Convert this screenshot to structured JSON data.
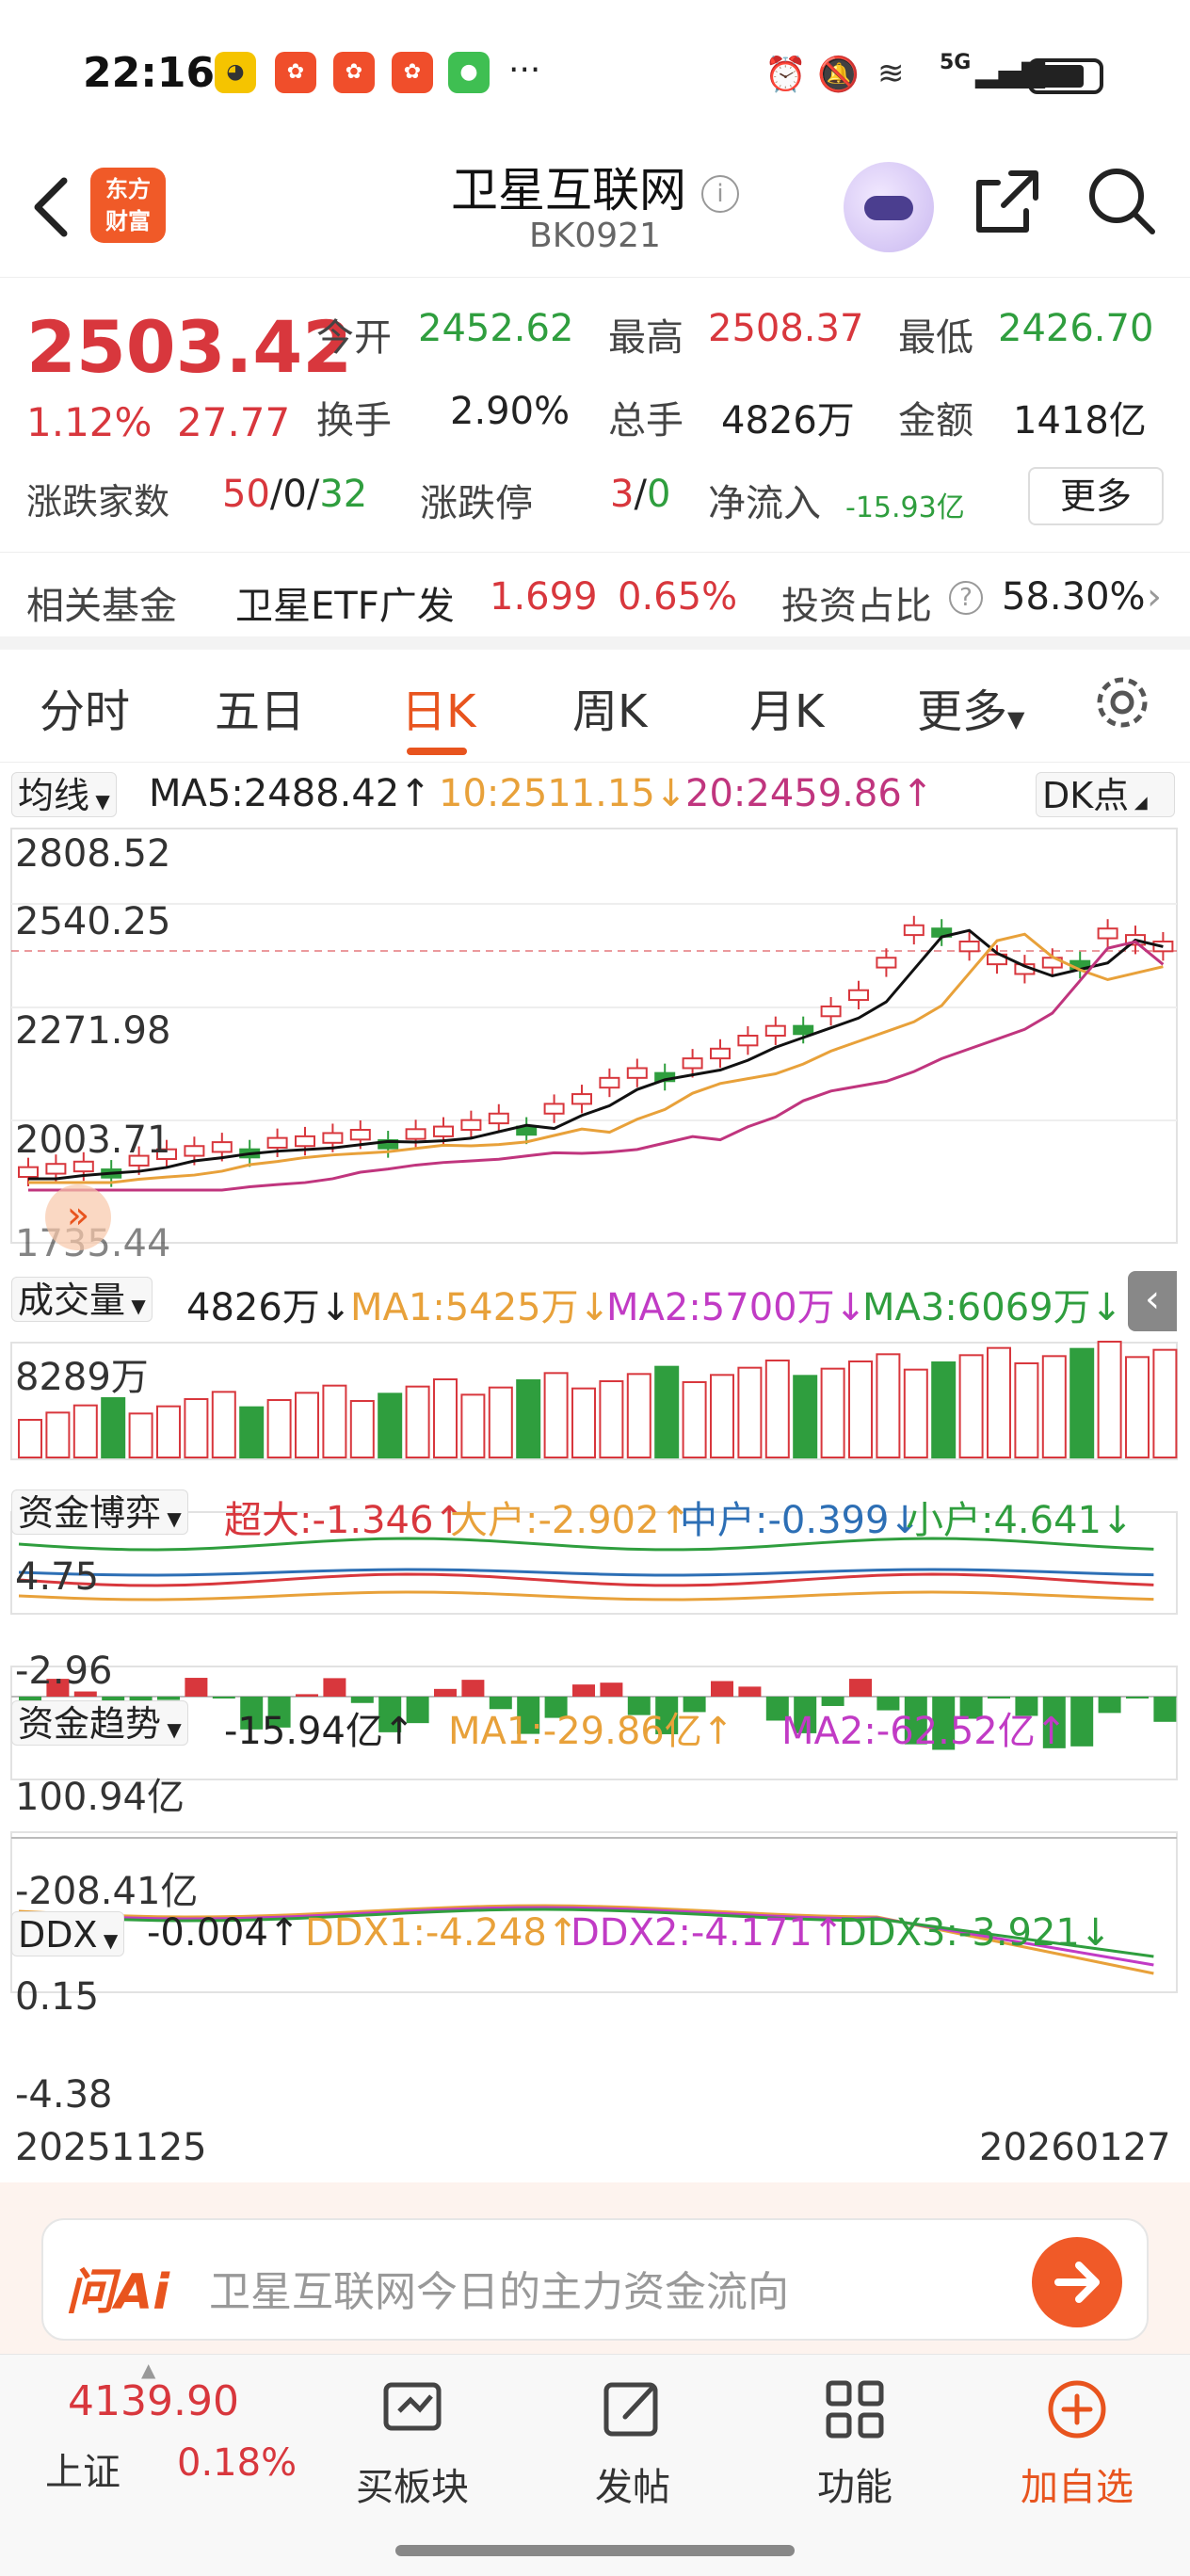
{
  "status_bar": {
    "time": "22:16",
    "network": "5G",
    "ellipsis": "···"
  },
  "header": {
    "title": "卫星互联网",
    "code": "BK0921",
    "logo_line1": "东方",
    "logo_line2": "财富"
  },
  "quote": {
    "price": "2503.42",
    "change_pct": "1.12%",
    "change": "27.77",
    "open_label": "今开",
    "open": "2452.62",
    "high_label": "最高",
    "high": "2508.37",
    "low_label": "最低",
    "low": "2426.70",
    "turnover_label": "换手",
    "turnover": "2.90%",
    "volume_label": "总手",
    "volume": "4826万",
    "amount_label": "金额",
    "amount": "1418亿",
    "adv_label": "涨跌家数",
    "adv_up": "50",
    "adv_sep1": "/",
    "adv_flat": "0",
    "adv_sep2": "/",
    "adv_down": "32",
    "limit_label": "涨跌停",
    "limit_up": "3",
    "limit_sep": "/",
    "limit_down": "0",
    "inflow_label": "净流入",
    "inflow": "-15.93亿",
    "more_label": "更多"
  },
  "fund": {
    "label": "相关基金",
    "name": "卫星ETF广发",
    "price": "1.699",
    "pct": "0.65%",
    "ratio_label": "投资占比",
    "ratio": "58.30%"
  },
  "tabs": [
    {
      "label": "分时"
    },
    {
      "label": "五日"
    },
    {
      "label": "日K"
    },
    {
      "label": "周K"
    },
    {
      "label": "月K"
    },
    {
      "label": "更多"
    }
  ],
  "ma_row": {
    "selector": "均线",
    "ma5": "MA5:2488.42↑",
    "ma10": "10:2511.15↓",
    "ma20": "20:2459.86↑",
    "dk": "DK点"
  },
  "price_axis": [
    "2808.52",
    "2540.25",
    "2271.98",
    "2003.71",
    "1735.44"
  ],
  "volume_row": {
    "selector": "成交量",
    "value": "4826万↓",
    "ma1": "MA1:5425万↓",
    "ma2": "MA2:5700万↓",
    "ma3": "MA3:6069万↓",
    "axis_top": "8289万"
  },
  "capital_row": {
    "selector": "资金博弈",
    "super": "超大:-1.346↑",
    "large": "大户:-2.902↑",
    "mid": "中户:-0.399↓",
    "small": "小户:4.641↓",
    "axis_top": "4.75",
    "axis_bottom": "-2.96"
  },
  "trend_row": {
    "selector": "资金趋势",
    "value": "-15.94亿↑",
    "ma1": "MA1:-29.86亿↑",
    "ma2": "MA2:-62.52亿↑",
    "axis_top": "100.94亿",
    "axis_bottom": "-208.41亿"
  },
  "ddx_row": {
    "selector": "DDX",
    "value": "-0.004↑",
    "ddx1": "DDX1:-4.248↑",
    "ddx2": "DDX2:-4.171↑",
    "ddx3": "DDX3:-3.921↓",
    "axis_top": "0.15",
    "axis_bottom": "-4.38"
  },
  "date_range": {
    "start": "20251125",
    "end": "20260127"
  },
  "ai_bar": {
    "brand": "问Ai",
    "prompt": "卫星互联网今日的主力资金流向"
  },
  "bottom_bar": {
    "index_value": "4139.90",
    "index_name": "上证",
    "index_pct": "0.18%",
    "items": [
      {
        "label": "买板块"
      },
      {
        "label": "发帖"
      },
      {
        "label": "功能"
      },
      {
        "label": "加自选"
      }
    ]
  },
  "colors": {
    "up": "#d8373d",
    "down": "#2f9e3e",
    "accent": "#e8541e",
    "ma5": "#111111",
    "ma10": "#e8a13a",
    "ma20": "#c0357e"
  }
}
